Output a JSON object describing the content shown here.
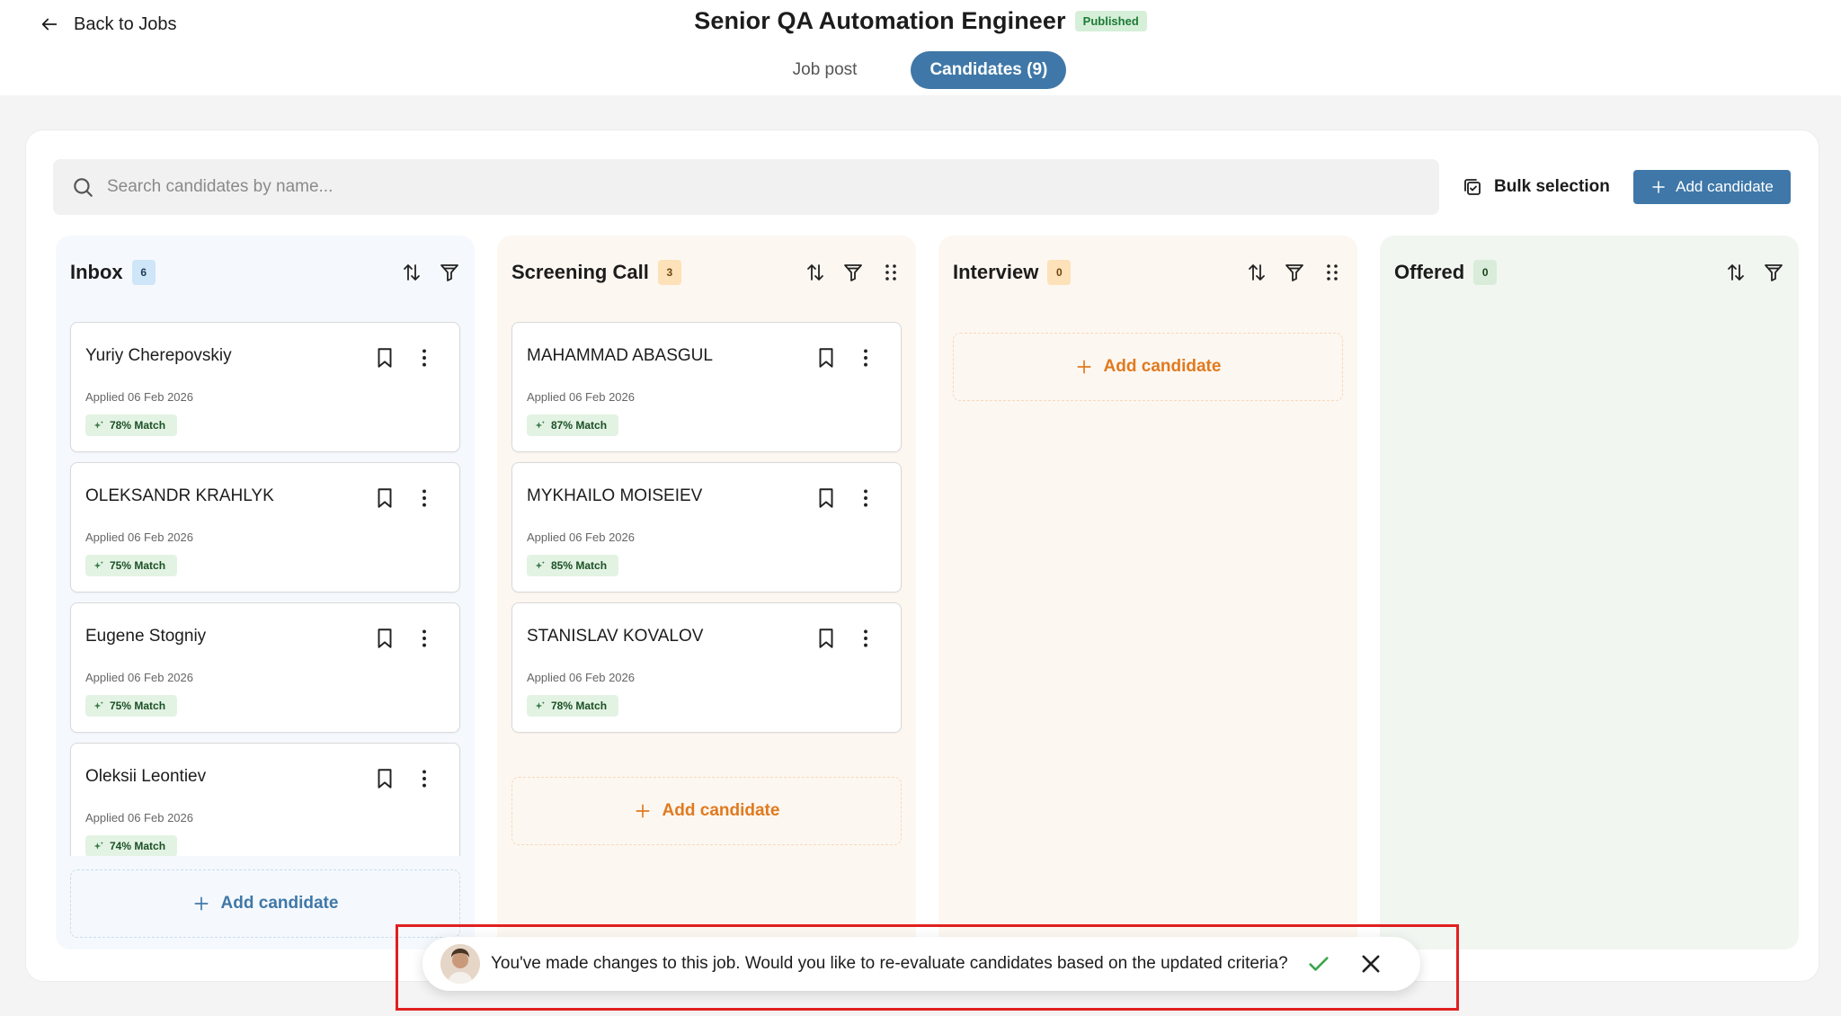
{
  "header": {
    "back_label": "Back to Jobs",
    "title": "Senior QA Automation Engineer",
    "status_badge": "Published",
    "tabs": [
      {
        "label": "Job post"
      },
      {
        "label": "Candidates (9)"
      }
    ]
  },
  "toolbar": {
    "search_placeholder": "Search candidates by name...",
    "bulk_label": "Bulk selection",
    "add_label": "Add candidate"
  },
  "columns": [
    {
      "title": "Inbox",
      "count": "6",
      "add_label": "Add candidate",
      "cards": [
        {
          "name": "Yuriy Cherepovskiy",
          "applied": "Applied 06 Feb 2026",
          "match": "78% Match"
        },
        {
          "name": "OLEKSANDR KRAHLYK",
          "applied": "Applied 06 Feb 2026",
          "match": "75% Match"
        },
        {
          "name": "Eugene Stogniy",
          "applied": "Applied 06 Feb 2026",
          "match": "75% Match"
        },
        {
          "name": "Oleksii Leontiev",
          "applied": "Applied 06 Feb 2026",
          "match": "74% Match"
        }
      ]
    },
    {
      "title": "Screening Call",
      "count": "3",
      "add_label": "Add candidate",
      "cards": [
        {
          "name": "MAHAMMAD ABASGUL",
          "applied": "Applied 06 Feb 2026",
          "match": "87% Match"
        },
        {
          "name": "MYKHAILO MOISEIEV",
          "applied": "Applied 06 Feb 2026",
          "match": "85% Match"
        },
        {
          "name": "STANISLAV KOVALOV",
          "applied": "Applied 06 Feb 2026",
          "match": "78% Match"
        }
      ]
    },
    {
      "title": "Interview",
      "count": "0",
      "add_label": "Add candidate",
      "cards": []
    },
    {
      "title": "Offered",
      "count": "0",
      "cards": []
    }
  ],
  "toast": {
    "message": "You've made changes to this job. Would you like to re-evaluate candidates based on the updated criteria?"
  },
  "colors": {
    "accent": "#3f78a8",
    "orange": "#e07a1f",
    "match_bg": "#e3f3e3",
    "highlight": "#e02020"
  }
}
